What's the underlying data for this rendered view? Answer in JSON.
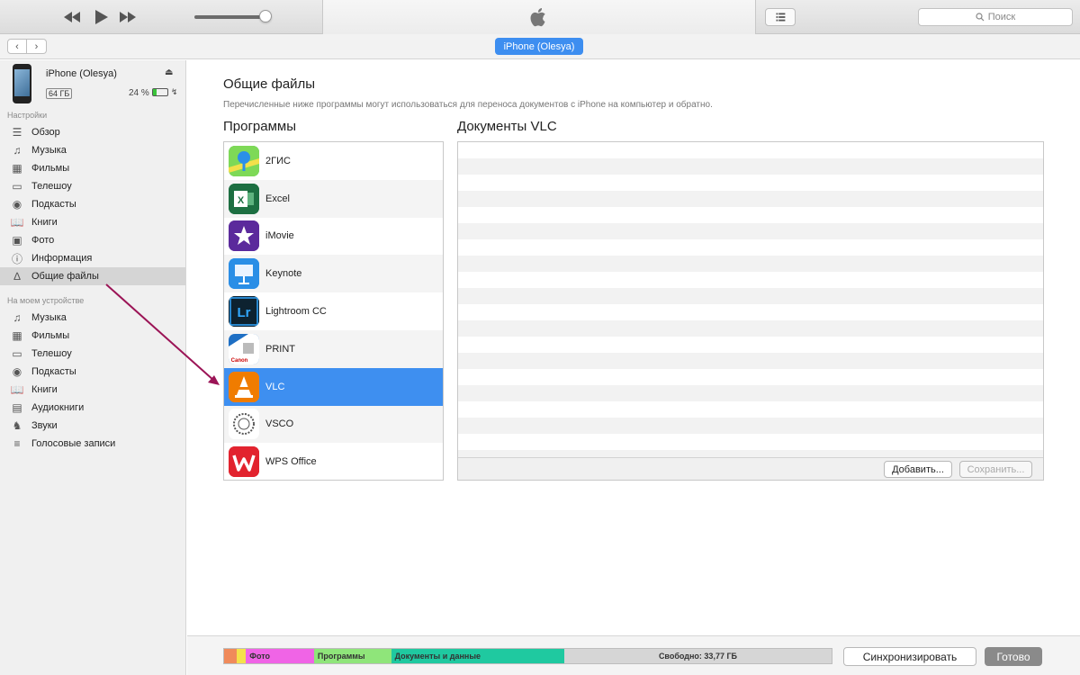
{
  "toolbar": {
    "rewind_icon": "rewind-icon",
    "play_icon": "play-icon",
    "forward_icon": "fast-forward-icon",
    "volume_fraction": 0.9,
    "logo_icon": "apple-logo-icon",
    "list_icon": "list-view-icon",
    "search_placeholder": "Поиск"
  },
  "navbar": {
    "back_icon": "chevron-left-icon",
    "forward_icon": "chevron-right-icon",
    "device_button": "iPhone (Olesya)"
  },
  "sidebar": {
    "device": {
      "name": "iPhone (Olesya)",
      "capacity": "64 ГБ",
      "battery": "24 %",
      "battery_fraction": 0.24
    },
    "settings_header": "Настройки",
    "settings": [
      {
        "label": "Обзор",
        "icon": "summary-icon"
      },
      {
        "label": "Музыка",
        "icon": "music-icon"
      },
      {
        "label": "Фильмы",
        "icon": "film-icon"
      },
      {
        "label": "Телешоу",
        "icon": "tv-icon"
      },
      {
        "label": "Подкасты",
        "icon": "podcast-icon"
      },
      {
        "label": "Книги",
        "icon": "book-icon"
      },
      {
        "label": "Фото",
        "icon": "camera-icon"
      },
      {
        "label": "Информация",
        "icon": "info-icon"
      },
      {
        "label": "Общие файлы",
        "icon": "apps-icon",
        "selected": true
      }
    ],
    "device_header": "На моем устройстве",
    "on_device": [
      {
        "label": "Музыка",
        "icon": "music-icon"
      },
      {
        "label": "Фильмы",
        "icon": "film-icon"
      },
      {
        "label": "Телешоу",
        "icon": "tv-icon"
      },
      {
        "label": "Подкасты",
        "icon": "podcast-icon"
      },
      {
        "label": "Книги",
        "icon": "book-icon"
      },
      {
        "label": "Аудиокниги",
        "icon": "audiobook-icon"
      },
      {
        "label": "Звуки",
        "icon": "bell-icon"
      },
      {
        "label": "Голосовые записи",
        "icon": "voice-memo-icon"
      }
    ]
  },
  "main": {
    "title": "Общие файлы",
    "description": "Перечисленные ниже программы могут использоваться для переноса документов с iPhone на компьютер и обратно.",
    "apps_title": "Программы",
    "docs_title": "Документы VLC",
    "apps": [
      {
        "name": "2ГИС",
        "color": "#2cb84b"
      },
      {
        "name": "Excel",
        "color": "#1d6f42"
      },
      {
        "name": "iMovie",
        "color": "#5b2a9c"
      },
      {
        "name": "Keynote",
        "color": "#2a8ee6"
      },
      {
        "name": "Lightroom CC",
        "color": "#0d2230"
      },
      {
        "name": "PRINT",
        "color": "#1e6fc4"
      },
      {
        "name": "VLC",
        "color": "#f07c00",
        "selected": true
      },
      {
        "name": "VSCO",
        "color": "#ffffff"
      },
      {
        "name": "WPS Office",
        "color": "#e2232e"
      }
    ],
    "add_button": "Добавить...",
    "save_button": "Сохранить..."
  },
  "storage": {
    "segments": [
      {
        "label": "",
        "color": "#f08a5a",
        "fraction": 0.02
      },
      {
        "label": "",
        "color": "#f5e14a",
        "fraction": 0.016
      },
      {
        "label": "Фото",
        "color": "#f064e6",
        "fraction": 0.112
      },
      {
        "label": "Программы",
        "color": "#8fe57a",
        "fraction": 0.127
      },
      {
        "label": "Документы и данные",
        "color": "#1fc9a0",
        "fraction": 0.285
      },
      {
        "label": "Свободно: 33,77 ГБ",
        "color": "#d6d6d6",
        "fraction": 0.44,
        "free": true
      }
    ],
    "sync_button": "Синхронизировать",
    "done_button": "Готово"
  }
}
